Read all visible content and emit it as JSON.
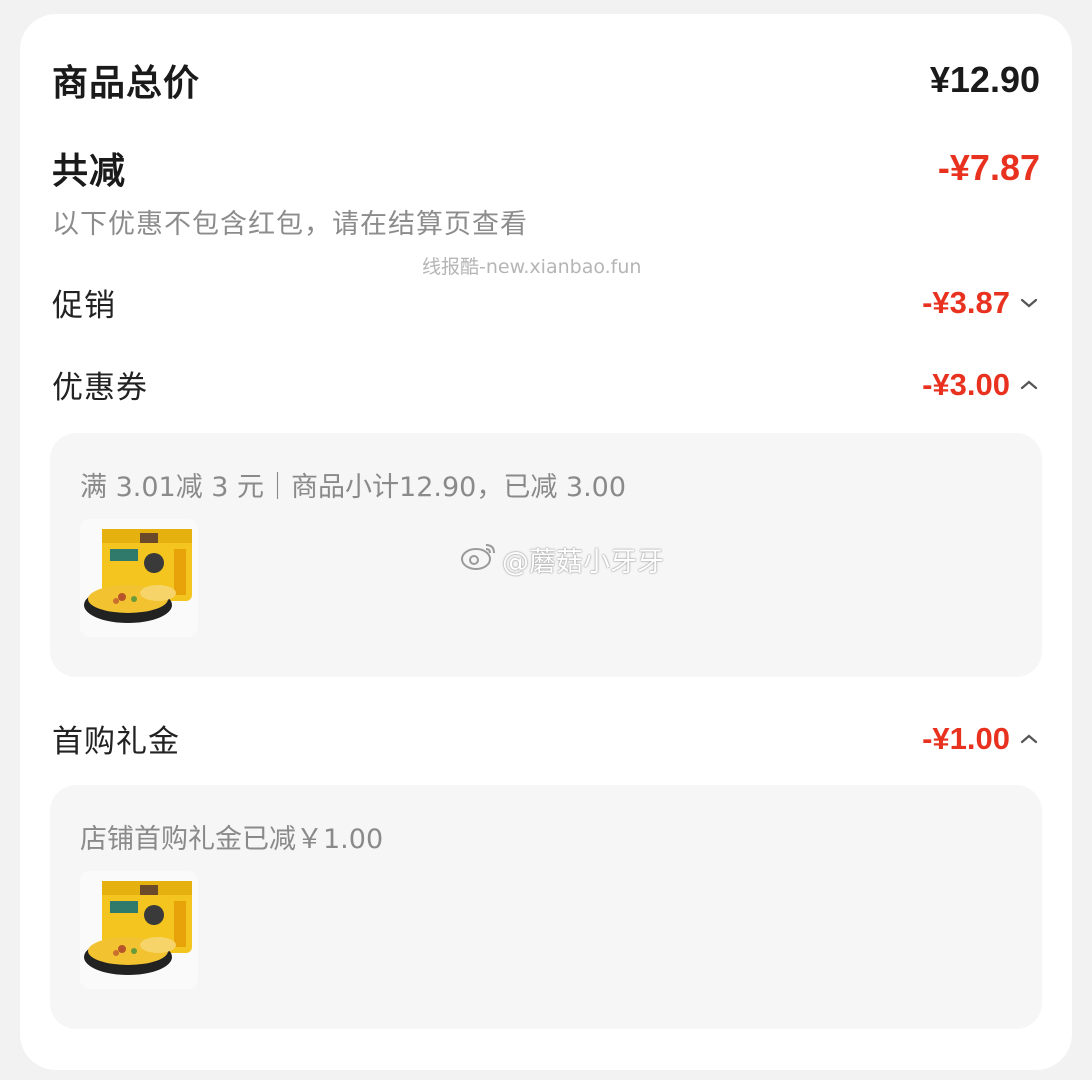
{
  "summary": {
    "total_label": "商品总价",
    "total_value": "¥12.90",
    "discount_label": "共减",
    "discount_value": "-¥7.87",
    "note": "以下优惠不包含红包，请在结算页查看"
  },
  "watermark_top": "线报酷-new.xianbao.fun",
  "watermark_weibo": "@蘑菇小牙牙",
  "promotion": {
    "label": "促销",
    "value": "-¥3.87",
    "state": "collapsed"
  },
  "coupon": {
    "label": "优惠券",
    "value": "-¥3.00",
    "state": "expanded",
    "detail": "满 3.01减 3 元｜商品小计12.90，已减 3.00"
  },
  "first_purchase": {
    "label": "首购礼金",
    "value": "-¥1.00",
    "state": "expanded",
    "detail": "店铺首购礼金已减￥1.00"
  },
  "colors": {
    "accent_red": "#e8321f",
    "panel_bg": "#f6f6f6",
    "muted_text": "#8c8c8c"
  },
  "icons": [
    "chevron-down-icon",
    "chevron-up-icon",
    "weibo-icon",
    "product-thumbnail"
  ]
}
